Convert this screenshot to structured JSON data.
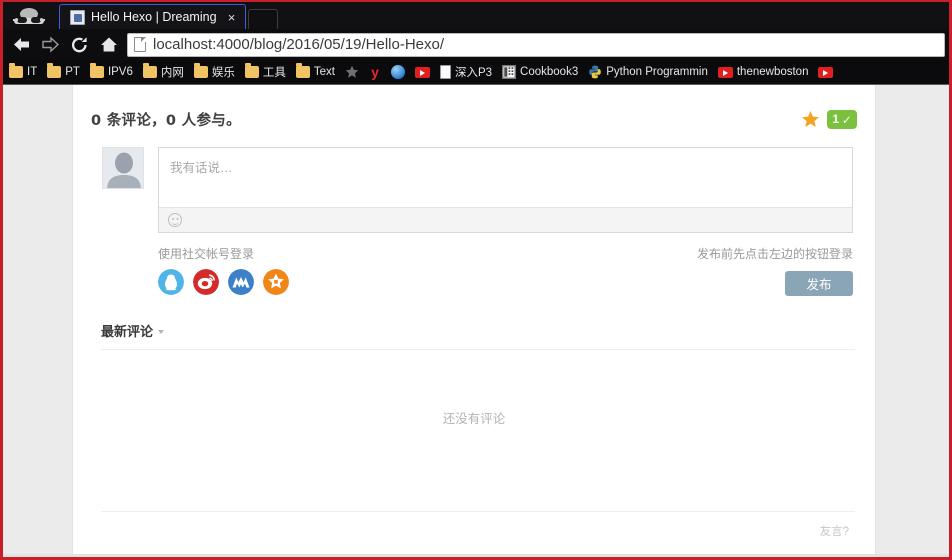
{
  "browser": {
    "incognito_icon": "spy-icon",
    "tab": {
      "title": "Hello Hexo | Dreaming",
      "favicon": "page-favicon",
      "close_label": "×"
    },
    "nav": {
      "back": "back-arrow-icon",
      "forward": "forward-arrow-icon",
      "reload": "reload-icon",
      "home": "home-icon"
    },
    "omnibox": {
      "url_prefix": "localhost:4000",
      "url_path": "/blog/2016/05/19/Hello-Hexo/",
      "full_url": "localhost:4000/blog/2016/05/19/Hello-Hexo/"
    },
    "bookmarks": [
      {
        "label": "IT",
        "icon": "folder-icon"
      },
      {
        "label": "PT",
        "icon": "folder-icon"
      },
      {
        "label": "IPV6",
        "icon": "folder-icon"
      },
      {
        "label": "内网",
        "icon": "folder-icon"
      },
      {
        "label": "娱乐",
        "icon": "folder-icon"
      },
      {
        "label": "工具",
        "icon": "folder-icon"
      },
      {
        "label": "Text",
        "icon": "folder-icon"
      },
      {
        "label": "",
        "icon": "star-icon"
      },
      {
        "label": "",
        "icon": "y-letter-icon"
      },
      {
        "label": "",
        "icon": "globe-icon"
      },
      {
        "label": "",
        "icon": "youtube-icon"
      },
      {
        "label": "深入P3",
        "icon": "document-icon"
      },
      {
        "label": "Cookbook3",
        "icon": "grid-icon"
      },
      {
        "label": "Python Programmin",
        "icon": "python-icon"
      },
      {
        "label": "thenewboston",
        "icon": "youtube-icon"
      },
      {
        "label": "",
        "icon": "youtube-icon"
      }
    ]
  },
  "comments": {
    "header": {
      "count_text": "0 条评论，0 人参与。",
      "star_icon": "star-icon",
      "badge_count": "1",
      "badge_check": "✓",
      "badge_color": "#7cc040",
      "star_color": "#f2a322"
    },
    "editor": {
      "avatar_icon": "default-avatar-icon",
      "placeholder": "我有话说…",
      "emoji_icon": "emoji-smiley-icon"
    },
    "login": {
      "hint": "使用社交帐号登录",
      "providers": [
        {
          "name": "qq-login-icon",
          "color": "#4fb4e8"
        },
        {
          "name": "weibo-login-icon",
          "color": "#d82b2b"
        },
        {
          "name": "renren-login-icon",
          "color": "#3d7fc8"
        },
        {
          "name": "sohu-login-icon",
          "color": "#f08518"
        }
      ]
    },
    "publish": {
      "hint": "发布前先点击左边的按钮登录",
      "button_label": "发布",
      "button_color": "#8aa6b6"
    },
    "latest": {
      "label": "最新评论",
      "caret_icon": "chevron-down-icon"
    },
    "empty_text": "还没有评论",
    "footer_brand": "友言?"
  }
}
